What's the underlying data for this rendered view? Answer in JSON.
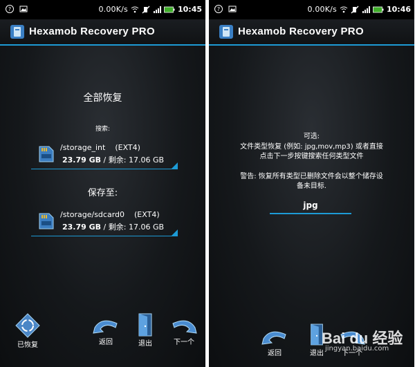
{
  "colors": {
    "accent": "#1d9bd6",
    "background": "#15181b",
    "statusbar": "#000000"
  },
  "left": {
    "status": {
      "speed": "0.00K/s",
      "time": "10:45"
    },
    "title": "Hexamob Recovery PRO",
    "heading": "全部恢复",
    "search_label": "搜索:",
    "source": {
      "path": "/storage_int",
      "fs": "(EXT4)",
      "size": "23.79 GB",
      "free": "/ 剩余: 17.06 GB"
    },
    "save_label": "保存至:",
    "target": {
      "path": "/storage/sdcard0",
      "fs": "(EXT4)",
      "size": "23.79 GB",
      "free": "/ 剩余: 17.06 GB"
    },
    "buttons": {
      "recovered": "已恢复",
      "back": "返回",
      "exit": "退出",
      "next": "下一个"
    }
  },
  "right": {
    "status": {
      "speed": "0.00K/s",
      "time": "10:46"
    },
    "title": "Hexamob Recovery PRO",
    "optional_label": "可选:",
    "desc_line1": "文件类型恢复 (例如: jpg,mov,mp3) 或者直接",
    "desc_line2": "点击下一步按键搜索任何类型文件",
    "warn_line1": "警告: 恢复所有类型已删除文件会以整个储存设",
    "warn_line2": "备未目标.",
    "input_value": "jpg",
    "buttons": {
      "back": "返回",
      "exit": "退出",
      "next": "下一个"
    }
  },
  "watermark": {
    "logo": "Bai du 经验",
    "url": "jingyan.baidu.com"
  },
  "icons": {
    "status_left": [
      "question-icon",
      "image-notification-icon"
    ],
    "status_right": [
      "wifi-icon",
      "mute-icon",
      "signal-icon",
      "battery-icon"
    ],
    "app": "hexamob-app-icon",
    "storage": "sd-card-icon",
    "recovered": "recycle-icon",
    "back": "back-arrow-icon",
    "exit": "exit-door-icon",
    "next": "next-arrow-icon"
  }
}
